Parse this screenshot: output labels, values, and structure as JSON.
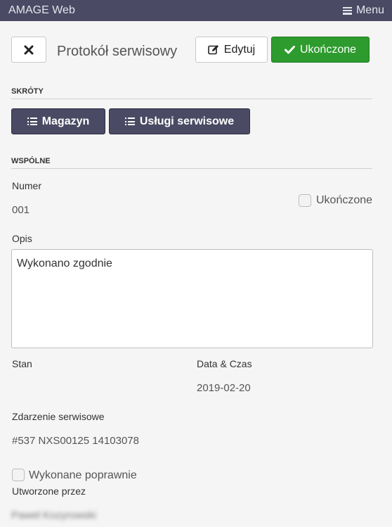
{
  "topbar": {
    "brand": "AMAGE Web",
    "menu_label": "Menu",
    "menu_icon": "hamburger-icon"
  },
  "header": {
    "close_icon": "close-icon",
    "title": "Protokół serwisowy",
    "edit_label": "Edytuj",
    "edit_icon": "pencil-square-icon",
    "done_label": "Ukończone",
    "done_icon": "checkmark-icon",
    "done_color": "#2d9b2d"
  },
  "shortcuts": {
    "heading": "SKRÓTY",
    "buttons": [
      {
        "label": "Magazyn",
        "icon": "list-icon"
      },
      {
        "label": "Usługi serwisowe",
        "icon": "list-icon"
      }
    ],
    "button_color": "#4a4a64"
  },
  "common": {
    "heading": "WSPÓLNE",
    "numer_label": "Numer",
    "numer_value": "001",
    "completed_checkbox_label": "Ukończone",
    "completed_checked": false,
    "opis_label": "Opis",
    "opis_value": "Wykonano zgodnie",
    "stan_label": "Stan",
    "stan_value": "",
    "datetime_label": "Data & Czas",
    "datetime_value": "2019-02-20",
    "event_label": "Zdarzenie serwisowe",
    "event_value": "#537 NXS00125 14103078",
    "correct_checkbox_label": "Wykonane poprawnie",
    "correct_checked": false,
    "created_by_label": "Utworzone przez",
    "created_by_value": "Paweł Kozyrowski"
  }
}
